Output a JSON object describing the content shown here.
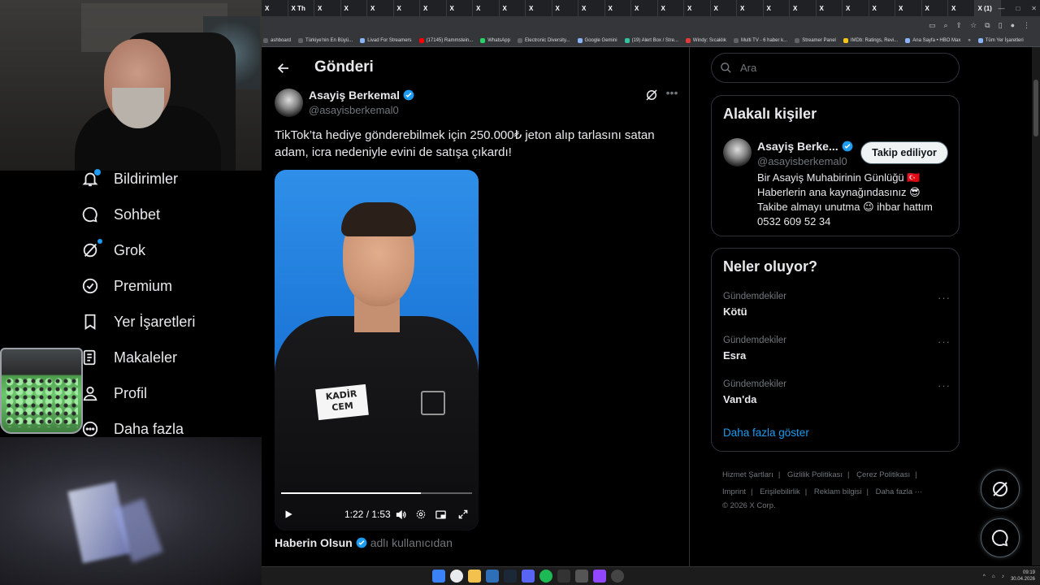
{
  "browser": {
    "tabs": [
      "X",
      "X Th",
      "X",
      "X",
      "X",
      "X",
      "X",
      "X",
      "X",
      "X",
      "X",
      "X",
      "X",
      "X",
      "X",
      "X",
      "X",
      "X",
      "X",
      "X",
      "X",
      "X",
      "X",
      "X",
      "X",
      "X",
      "X",
      "X (1)"
    ],
    "bookmarks": [
      {
        "label": "ashboard",
        "color": "#5f6368"
      },
      {
        "label": "Türkiye'nin En Büyü...",
        "color": "#5f6368"
      },
      {
        "label": "Livad For Streamers",
        "color": "#8ab4f8"
      },
      {
        "label": "(17145) Rammstein...",
        "color": "#ff0000"
      },
      {
        "label": "WhatsApp",
        "color": "#25d366"
      },
      {
        "label": "Electronic Diversity...",
        "color": "#5f6368"
      },
      {
        "label": "Google Gemini",
        "color": "#8ab4f8"
      },
      {
        "label": "(19) Alert Box / Stre...",
        "color": "#31c3a2"
      },
      {
        "label": "Windy: Sıcaklık",
        "color": "#e53935"
      },
      {
        "label": "Multi TV - 6 haber k...",
        "color": "#5f6368"
      },
      {
        "label": "Streamer Panel",
        "color": "#5f6368"
      },
      {
        "label": "IMDb: Ratings, Revi...",
        "color": "#f5c518"
      },
      {
        "label": "Ana Sayfa • HBO Max",
        "color": "#8ab4f8"
      },
      {
        "label": "»",
        "color": ""
      },
      {
        "label": "Tüm Yer İşaretleri",
        "color": "#8ab4f8"
      }
    ]
  },
  "sidenav": {
    "items": [
      {
        "label": "Bildirimler",
        "icon": "bell-icon"
      },
      {
        "label": "Sohbet",
        "icon": "chat-icon"
      },
      {
        "label": "Grok",
        "icon": "grok-icon"
      },
      {
        "label": "Premium",
        "icon": "premium-icon"
      },
      {
        "label": "Yer İşaretleri",
        "icon": "bookmark-icon"
      },
      {
        "label": "Makaleler",
        "icon": "articles-icon"
      },
      {
        "label": "Profil",
        "icon": "profile-icon"
      },
      {
        "label": "Daha fazla",
        "icon": "more-icon"
      }
    ]
  },
  "main": {
    "title": "Gönderi",
    "author": {
      "name": "Asayiş Berkemal",
      "handle": "@asayisberkemal0"
    },
    "text": "TikTok’ta hediye gönderebilmek için 250.000₺ jeton alıp tarlasını satan adam, icra nedeniyle evini de satışa çıkardı!",
    "video": {
      "badge_line1": "KADİR",
      "badge_line2": "CEM",
      "time": "1:22 / 1:53",
      "progress": 0.73
    },
    "source": {
      "name": "Haberin Olsun",
      "suffix": "adlı kullanıcıdan"
    }
  },
  "right": {
    "search_placeholder": "Ara",
    "related": {
      "title": "Alakalı kişiler",
      "name": "Asayiş Berke...",
      "handle": "@asayisberkemal0",
      "follow_label": "Takip ediliyor",
      "bio_lines": [
        "Bir Asayiş Muhabirinin Günlüğü 🇹🇷",
        "Haberlerin ana kaynağındasınız 😎",
        "Takibe almayı unutma 😉 ihbar hattım",
        "0532 609 52 34"
      ]
    },
    "trends": {
      "title": "Neler oluyor?",
      "items": [
        {
          "category": "Gündemdekiler",
          "name": "Kötü"
        },
        {
          "category": "Gündemdekiler",
          "name": "Esra"
        },
        {
          "category": "Gündemdekiler",
          "name": "Van'da"
        }
      ],
      "more_dots": "···",
      "show_more": "Daha fazla göster"
    },
    "footer": {
      "line1": [
        "Hizmet Şartları",
        "Gizlilik Politikası",
        "Çerez Politikası"
      ],
      "line2": [
        "Imprint",
        "Erişilebilirlik",
        "Reklam bilgisi",
        "Daha fazla ···"
      ],
      "copyright": "© 2026 X Corp."
    }
  },
  "taskbar": {
    "time": "09:19",
    "date": "30.04.2026"
  },
  "colors": {
    "accent": "#1d9bf0",
    "text": "#e7e9ea",
    "muted": "#71767b",
    "border": "#2f3336"
  }
}
